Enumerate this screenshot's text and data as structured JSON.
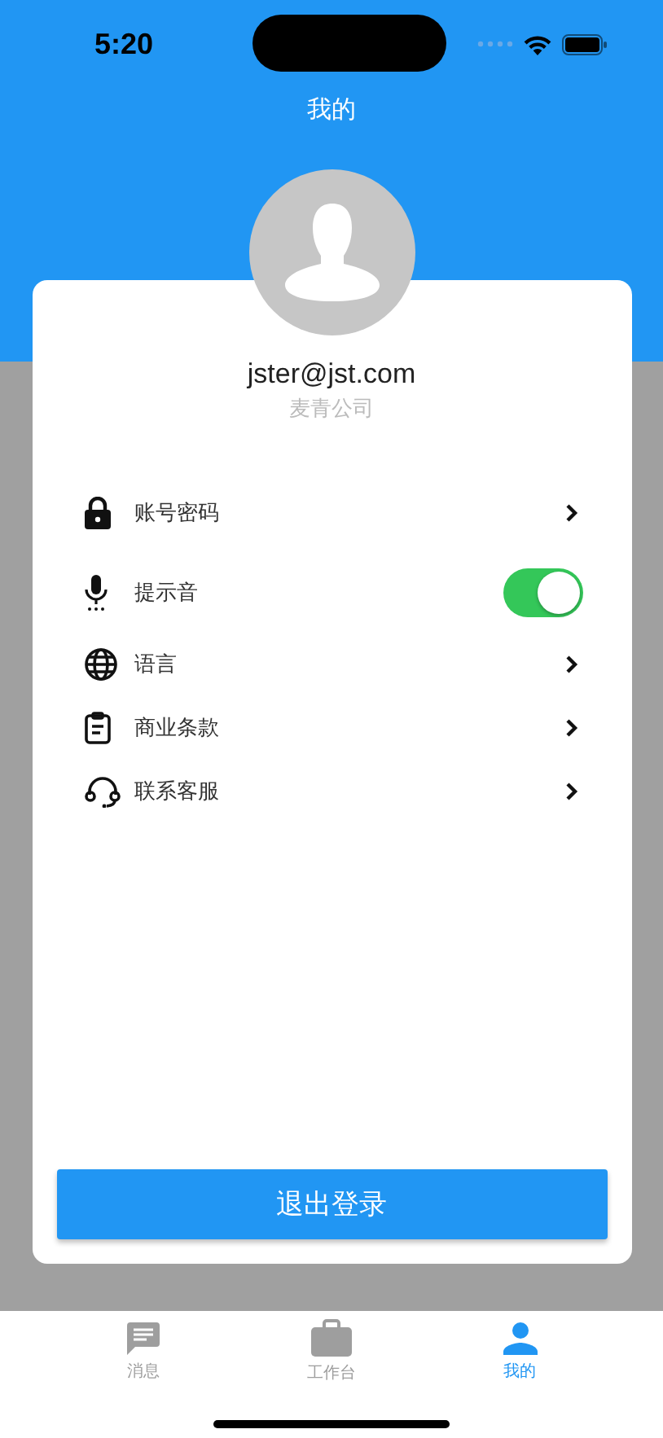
{
  "status_bar": {
    "time": "5:20"
  },
  "header": {
    "title": "我的"
  },
  "profile": {
    "email": "jster@jst.com",
    "company": "麦青公司"
  },
  "menu": [
    {
      "kind": "link",
      "label": "账号密码"
    },
    {
      "kind": "toggle",
      "label": "提示音",
      "on": true
    },
    {
      "kind": "link",
      "label": "语言"
    },
    {
      "kind": "link",
      "label": "商业条款"
    },
    {
      "kind": "link",
      "label": "联系客服"
    }
  ],
  "logout_button": "退出登录",
  "tabs": [
    {
      "label": "消息",
      "selected": false
    },
    {
      "label": "工作台",
      "selected": false
    },
    {
      "label": "我的",
      "selected": true
    }
  ]
}
